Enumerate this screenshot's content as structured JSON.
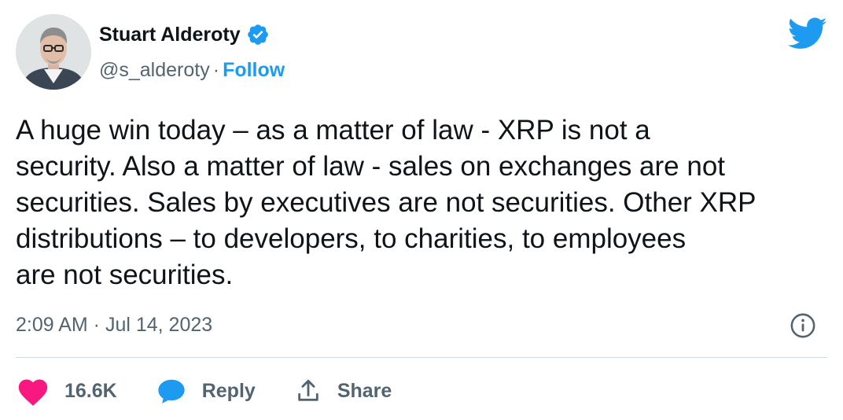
{
  "author": {
    "name": "Stuart Alderoty",
    "handle": "@s_alderoty",
    "separator": "·",
    "follow_label": "Follow",
    "verified_icon": "verified-badge-icon",
    "avatar": "avatar-photo"
  },
  "brand_icon": "twitter-bird-icon",
  "tweet": {
    "text": "A huge win today – as a matter of law - XRP is not a\nsecurity. Also a matter of law - sales on exchanges are not\nsecurities. Sales by executives are not securities. Other XRP\ndistributions – to developers, to charities, to employees\nare not securities.",
    "timestamp": "2:09 AM · Jul 14, 2023"
  },
  "actions": {
    "like_count": "16.6K",
    "reply_label": "Reply",
    "share_label": "Share"
  },
  "colors": {
    "accent": "#1d9bf0",
    "like": "#f91880",
    "text": "#0f1419",
    "muted": "#536471",
    "divider": "#cfd9de"
  }
}
